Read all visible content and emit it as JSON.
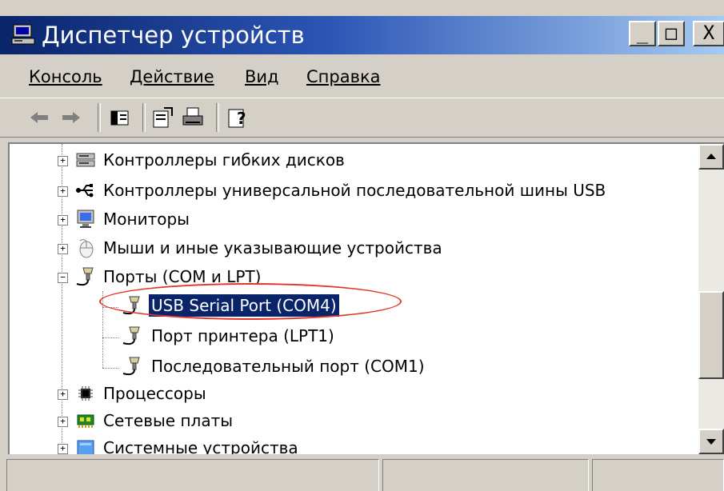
{
  "window": {
    "title": "Диспетчер устройств"
  },
  "title_buttons": {
    "minimize": "_",
    "maximize": "□",
    "close": "X"
  },
  "menu": [
    {
      "label": "Консоль"
    },
    {
      "label": "Действие"
    },
    {
      "label": "Вид"
    },
    {
      "label": "Справка"
    }
  ],
  "toolbar": {
    "icons": [
      "back-icon",
      "forward-icon",
      "show-hide-tree-icon",
      "properties-icon",
      "print-icon",
      "help-icon"
    ]
  },
  "tree": {
    "items": [
      {
        "label": "Контроллеры гибких дисков",
        "expander": "+",
        "icon": "floppy-controller-icon"
      },
      {
        "label": "Контроллеры универсальной последовательной шины USB",
        "expander": "+",
        "icon": "usb-controller-icon"
      },
      {
        "label": "Мониторы",
        "expander": "+",
        "icon": "monitor-icon"
      },
      {
        "label": "Мыши и иные указывающие устройства",
        "expander": "+",
        "icon": "mouse-icon"
      },
      {
        "label": "Порты (COM и LPT)",
        "expander": "−",
        "icon": "port-icon",
        "children": [
          {
            "label": "USB Serial Port (COM4)",
            "icon": "port-icon",
            "selected": true
          },
          {
            "label": "Порт принтера (LPT1)",
            "icon": "port-icon"
          },
          {
            "label": "Последовательный порт (COM1)",
            "icon": "port-icon"
          }
        ]
      },
      {
        "label": "Процессоры",
        "expander": "+",
        "icon": "processor-icon"
      },
      {
        "label": "Сетевые платы",
        "expander": "+",
        "icon": "network-card-icon"
      },
      {
        "label": "Системные устройства",
        "expander": "+",
        "icon": "system-device-icon"
      }
    ]
  },
  "colors": {
    "selection": "#0a246a",
    "annotation": "#e3342a",
    "title_start": "#0a246a",
    "title_end": "#a6caf0"
  }
}
